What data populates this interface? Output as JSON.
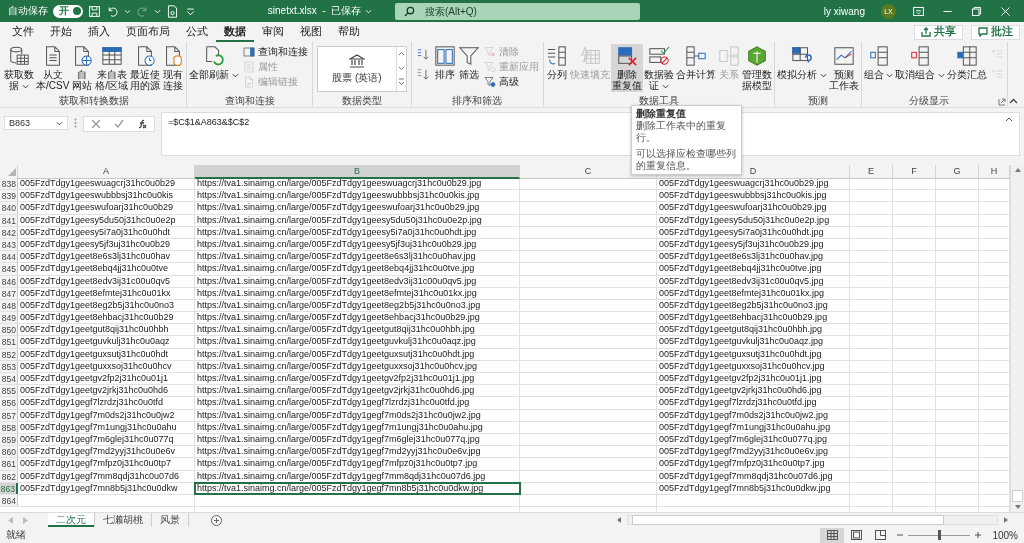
{
  "title_bar": {
    "autosave": {
      "label": "自动保存",
      "on": true,
      "state_label": "开"
    },
    "redo_disabled": true,
    "file_title": "sinetxt.xlsx  -  已保存",
    "search": {
      "placeholder": "搜索(Alt+Q)"
    },
    "user": {
      "name": "ly xiwang",
      "initials": "LX"
    }
  },
  "menu_tabs": [
    {
      "label": "文件",
      "selected": false
    },
    {
      "label": "开始",
      "selected": false
    },
    {
      "label": "插入",
      "selected": false
    },
    {
      "label": "页面布局",
      "selected": false
    },
    {
      "label": "公式",
      "selected": false
    },
    {
      "label": "数据",
      "selected": true
    },
    {
      "label": "审阅",
      "selected": false
    },
    {
      "label": "视图",
      "selected": false
    },
    {
      "label": "帮助",
      "selected": false
    }
  ],
  "share": {
    "label": "共享"
  },
  "comments": {
    "label": "批注"
  },
  "ribbon": {
    "groups": [
      {
        "label": "获取和转换数据",
        "items": [
          {
            "kind": "large",
            "lines": [
              "获取数",
              "据"
            ],
            "dropdown": true,
            "disabled": false,
            "hovered": false
          },
          {
            "kind": "large",
            "lines": [
              "从文",
              "本/CSV"
            ],
            "dropdown": false,
            "disabled": false,
            "hovered": false
          },
          {
            "kind": "large",
            "lines": [
              "自",
              "网站"
            ],
            "dropdown": false,
            "disabled": false,
            "hovered": false
          },
          {
            "kind": "large",
            "lines": [
              "来自表",
              "格/区域"
            ],
            "dropdown": false,
            "disabled": false,
            "hovered": false
          },
          {
            "kind": "large",
            "lines": [
              "最近使",
              "用的源"
            ],
            "dropdown": false,
            "disabled": false,
            "hovered": false
          },
          {
            "kind": "large",
            "lines": [
              "现有",
              "连接"
            ],
            "dropdown": false,
            "disabled": false,
            "hovered": false
          }
        ]
      },
      {
        "label": "查询和连接",
        "items": [
          {
            "kind": "large",
            "lines": [
              "全部刷新"
            ],
            "dropdown": true,
            "disabled": false,
            "hovered": false
          },
          {
            "kind": "stack",
            "items": [
              {
                "label": "查询和连接",
                "disabled": false
              },
              {
                "label": "属性",
                "disabled": true
              },
              {
                "label": "编辑链接",
                "disabled": true
              }
            ]
          }
        ]
      },
      {
        "label": "数据类型",
        "items": [
          {
            "kind": "gallery",
            "label": "股票 (英语)"
          }
        ]
      },
      {
        "label": "排序和筛选",
        "items": [
          {
            "kind": "sort-stack"
          },
          {
            "kind": "large",
            "lines": [
              "排序"
            ],
            "dropdown": false,
            "disabled": false,
            "hovered": false
          },
          {
            "kind": "large",
            "lines": [
              "筛选"
            ],
            "dropdown": false,
            "disabled": false,
            "hovered": false
          },
          {
            "kind": "stack",
            "items": [
              {
                "label": "清除",
                "disabled": true
              },
              {
                "label": "重新应用",
                "disabled": true
              },
              {
                "label": "高级",
                "disabled": false
              }
            ]
          }
        ]
      },
      {
        "label": "数据工具",
        "items": [
          {
            "kind": "large",
            "lines": [
              "分列"
            ],
            "dropdown": false,
            "disabled": false,
            "hovered": false
          },
          {
            "kind": "large",
            "lines": [
              "快速填充"
            ],
            "dropdown": false,
            "disabled": true,
            "hovered": false
          },
          {
            "kind": "large",
            "lines": [
              "删除",
              "重复值"
            ],
            "dropdown": false,
            "disabled": false,
            "hovered": true
          },
          {
            "kind": "large",
            "lines": [
              "数据验",
              "证"
            ],
            "dropdown": true,
            "disabled": false,
            "hovered": false
          },
          {
            "kind": "large",
            "lines": [
              "合并计算"
            ],
            "dropdown": false,
            "disabled": false,
            "hovered": false
          },
          {
            "kind": "large",
            "lines": [
              "关系"
            ],
            "dropdown": false,
            "disabled": true,
            "hovered": false
          },
          {
            "kind": "large",
            "lines": [
              "管理数",
              "据模型"
            ],
            "dropdown": false,
            "disabled": false,
            "hovered": false
          }
        ]
      },
      {
        "label": "预测",
        "items": [
          {
            "kind": "large",
            "lines": [
              "模拟分析"
            ],
            "dropdown": true,
            "disabled": false,
            "hovered": false
          },
          {
            "kind": "large",
            "lines": [
              "预测",
              "工作表"
            ],
            "dropdown": false,
            "disabled": false,
            "hovered": false
          }
        ]
      },
      {
        "label": "分级显示",
        "launcher": true,
        "items": [
          {
            "kind": "large",
            "lines": [
              "组合"
            ],
            "dropdown": true,
            "disabled": false,
            "hovered": false
          },
          {
            "kind": "large",
            "lines": [
              "取消组合"
            ],
            "dropdown": true,
            "disabled": false,
            "hovered": false
          },
          {
            "kind": "large",
            "lines": [
              "分类汇总"
            ],
            "dropdown": false,
            "disabled": false,
            "hovered": false
          },
          {
            "kind": "outline-stack",
            "disabled": true
          }
        ]
      }
    ]
  },
  "formula_bar": {
    "name_box": "B863",
    "formula": "=$C$1&A863&$C$2"
  },
  "tooltip": {
    "title": "删除重复值",
    "lines": [
      "删除工作表中的重复行。",
      "可以选择应检查哪些列的重复信息。"
    ]
  },
  "columns": [
    {
      "label": "A",
      "selected": false
    },
    {
      "label": "B",
      "selected": true
    },
    {
      "label": "C",
      "selected": false
    },
    {
      "label": "D",
      "selected": false
    },
    {
      "label": "E",
      "selected": false
    },
    {
      "label": "F",
      "selected": false
    },
    {
      "label": "G",
      "selected": false
    },
    {
      "label": "H",
      "selected": false
    }
  ],
  "rows": [
    {
      "header": "838",
      "selected": false,
      "a": "005FzdTdgy1geeswuagcrj31hc0u0b29",
      "b": "https://tva1.sinaimg.cn/large/005FzdTdgy1geeswuagcrj31hc0u0b29.jpg",
      "d": "005FzdTdgy1geeswuagcrj31hc0u0b29.jpg"
    },
    {
      "header": "839",
      "selected": false,
      "a": "005FzdTdgy1geeswubbbsj31hc0u0kis",
      "b": "https://tva1.sinaimg.cn/large/005FzdTdgy1geeswubbbsj31hc0u0kis.jpg",
      "d": "005FzdTdgy1geeswubbbsj31hc0u0kis.jpg"
    },
    {
      "header": "840",
      "selected": false,
      "a": "005FzdTdgy1geeswufoarj31hc0u0b29",
      "b": "https://tva1.sinaimg.cn/large/005FzdTdgy1geeswufoarj31hc0u0b29.jpg",
      "d": "005FzdTdgy1geeswufoarj31hc0u0b29.jpg"
    },
    {
      "header": "841",
      "selected": false,
      "a": "005FzdTdgy1geesy5du50j31hc0u0e2p",
      "b": "https://tva1.sinaimg.cn/large/005FzdTdgy1geesy5du50j31hc0u0e2p.jpg",
      "d": "005FzdTdgy1geesy5du50j31hc0u0e2p.jpg"
    },
    {
      "header": "842",
      "selected": false,
      "a": "005FzdTdgy1geesy5i7a0j31hc0u0hdt",
      "b": "https://tva1.sinaimg.cn/large/005FzdTdgy1geesy5i7a0j31hc0u0hdt.jpg",
      "d": "005FzdTdgy1geesy5i7a0j31hc0u0hdt.jpg"
    },
    {
      "header": "843",
      "selected": false,
      "a": "005FzdTdgy1geesy5jf3uj31hc0u0b29",
      "b": "https://tva1.sinaimg.cn/large/005FzdTdgy1geesy5jf3uj31hc0u0b29.jpg",
      "d": "005FzdTdgy1geesy5jf3uj31hc0u0b29.jpg"
    },
    {
      "header": "844",
      "selected": false,
      "a": "005FzdTdgy1geet8e6s3lj31hc0u0hav",
      "b": "https://tva1.sinaimg.cn/large/005FzdTdgy1geet8e6s3lj31hc0u0hav.jpg",
      "d": "005FzdTdgy1geet8e6s3lj31hc0u0hav.jpg"
    },
    {
      "header": "845",
      "selected": false,
      "a": "005FzdTdgy1geet8ebq4jj31hc0u0tve",
      "b": "https://tva1.sinaimg.cn/large/005FzdTdgy1geet8ebq4jj31hc0u0tve.jpg",
      "d": "005FzdTdgy1geet8ebq4jj31hc0u0tve.jpg"
    },
    {
      "header": "846",
      "selected": false,
      "a": "005FzdTdgy1geet8edv3ij31c00u0qv5",
      "b": "https://tva1.sinaimg.cn/large/005FzdTdgy1geet8edv3ij31c00u0qv5.jpg",
      "d": "005FzdTdgy1geet8edv3ij31c00u0qv5.jpg"
    },
    {
      "header": "847",
      "selected": false,
      "a": "005FzdTdgy1geet8efmtej31hc0u01kx",
      "b": "https://tva1.sinaimg.cn/large/005FzdTdgy1geet8efmtej31hc0u01kx.jpg",
      "d": "005FzdTdgy1geet8efmtej31hc0u01kx.jpg"
    },
    {
      "header": "848",
      "selected": false,
      "a": "005FzdTdgy1geet8eg2b5j31hc0u0no3",
      "b": "https://tva1.sinaimg.cn/large/005FzdTdgy1geet8eg2b5j31hc0u0no3.jpg",
      "d": "005FzdTdgy1geet8eg2b5j31hc0u0no3.jpg"
    },
    {
      "header": "849",
      "selected": false,
      "a": "005FzdTdgy1geet8ehbacj31hc0u0b29",
      "b": "https://tva1.sinaimg.cn/large/005FzdTdgy1geet8ehbacj31hc0u0b29.jpg",
      "d": "005FzdTdgy1geet8ehbacj31hc0u0b29.jpg"
    },
    {
      "header": "850",
      "selected": false,
      "a": "005FzdTdgy1geetgut8qij31hc0u0hbh",
      "b": "https://tva1.sinaimg.cn/large/005FzdTdgy1geetgut8qij31hc0u0hbh.jpg",
      "d": "005FzdTdgy1geetgut8qij31hc0u0hbh.jpg"
    },
    {
      "header": "851",
      "selected": false,
      "a": "005FzdTdgy1geetguvkulj31hc0u0aqz",
      "b": "https://tva1.sinaimg.cn/large/005FzdTdgy1geetguvkulj31hc0u0aqz.jpg",
      "d": "005FzdTdgy1geetguvkulj31hc0u0aqz.jpg"
    },
    {
      "header": "852",
      "selected": false,
      "a": "005FzdTdgy1geetguxsutj31hc0u0hdt",
      "b": "https://tva1.sinaimg.cn/large/005FzdTdgy1geetguxsutj31hc0u0hdt.jpg",
      "d": "005FzdTdgy1geetguxsutj31hc0u0hdt.jpg"
    },
    {
      "header": "853",
      "selected": false,
      "a": "005FzdTdgy1geetguxxsoj31hc0u0hcv",
      "b": "https://tva1.sinaimg.cn/large/005FzdTdgy1geetguxxsoj31hc0u0hcv.jpg",
      "d": "005FzdTdgy1geetguxxsoj31hc0u0hcv.jpg"
    },
    {
      "header": "854",
      "selected": false,
      "a": "005FzdTdgy1geetgv2fp2j31hc0u01j1",
      "b": "https://tva1.sinaimg.cn/large/005FzdTdgy1geetgv2fp2j31hc0u01j1.jpg",
      "d": "005FzdTdgy1geetgv2fp2j31hc0u01j1.jpg"
    },
    {
      "header": "855",
      "selected": false,
      "a": "005FzdTdgy1geetgv2jrkj31hc0u0hd6",
      "b": "https://tva1.sinaimg.cn/large/005FzdTdgy1geetgv2jrkj31hc0u0hd6.jpg",
      "d": "005FzdTdgy1geetgv2jrkj31hc0u0hd6.jpg"
    },
    {
      "header": "856",
      "selected": false,
      "a": "005FzdTdgy1gegf7lzrdzj31hc0u0tfd",
      "b": "https://tva1.sinaimg.cn/large/005FzdTdgy1gegf7lzrdzj31hc0u0tfd.jpg",
      "d": "005FzdTdgy1gegf7lzrdzj31hc0u0tfd.jpg"
    },
    {
      "header": "857",
      "selected": false,
      "a": "005FzdTdgy1gegf7m0ds2j31hc0u0jw2",
      "b": "https://tva1.sinaimg.cn/large/005FzdTdgy1gegf7m0ds2j31hc0u0jw2.jpg",
      "d": "005FzdTdgy1gegf7m0ds2j31hc0u0jw2.jpg"
    },
    {
      "header": "858",
      "selected": false,
      "a": "005FzdTdgy1gegf7m1ungj31hc0u0ahu",
      "b": "https://tva1.sinaimg.cn/large/005FzdTdgy1gegf7m1ungj31hc0u0ahu.jpg",
      "d": "005FzdTdgy1gegf7m1ungj31hc0u0ahu.jpg"
    },
    {
      "header": "859",
      "selected": false,
      "a": "005FzdTdgy1gegf7m6glej31hc0u077q",
      "b": "https://tva1.sinaimg.cn/large/005FzdTdgy1gegf7m6glej31hc0u077q.jpg",
      "d": "005FzdTdgy1gegf7m6glej31hc0u077q.jpg"
    },
    {
      "header": "860",
      "selected": false,
      "a": "005FzdTdgy1gegf7md2yyj31hc0u0e6v",
      "b": "https://tva1.sinaimg.cn/large/005FzdTdgy1gegf7md2yyj31hc0u0e6v.jpg",
      "d": "005FzdTdgy1gegf7md2yyj31hc0u0e6v.jpg"
    },
    {
      "header": "861",
      "selected": false,
      "a": "005FzdTdgy1gegf7mfpz0j31hc0u0tp7",
      "b": "https://tva1.sinaimg.cn/large/005FzdTdgy1gegf7mfpz0j31hc0u0tp7.jpg",
      "d": "005FzdTdgy1gegf7mfpz0j31hc0u0tp7.jpg"
    },
    {
      "header": "862",
      "selected": false,
      "a": "005FzdTdgy1gegf7mm8qdj31hc0u07d6",
      "b": "https://tva1.sinaimg.cn/large/005FzdTdgy1gegf7mm8qdj31hc0u07d6.jpg",
      "d": "005FzdTdgy1gegf7mm8qdj31hc0u07d6.jpg"
    },
    {
      "header": "863",
      "selected": true,
      "a": "005FzdTdgy1gegf7mn8b5j31hc0u0dkw",
      "b": "https://tva1.sinaimg.cn/large/005FzdTdgy1gegf7mn8b5j31hc0u0dkw.jpg",
      "d": "005FzdTdgy1gegf7mn8b5j31hc0u0dkw.jpg"
    },
    {
      "header": "864",
      "selected": false
    }
  ],
  "sheets": [
    {
      "label": "二次元",
      "selected": true
    },
    {
      "label": "七濑胡桃",
      "selected": false
    },
    {
      "label": "风景",
      "selected": false
    }
  ],
  "status_bar": {
    "text": "就绪",
    "views": [
      {
        "kind": "normal",
        "selected": true
      },
      {
        "kind": "page-layout",
        "selected": false
      },
      {
        "kind": "page-break",
        "selected": false
      }
    ],
    "zoom": {
      "level": 0.5,
      "reading": "100%"
    }
  }
}
